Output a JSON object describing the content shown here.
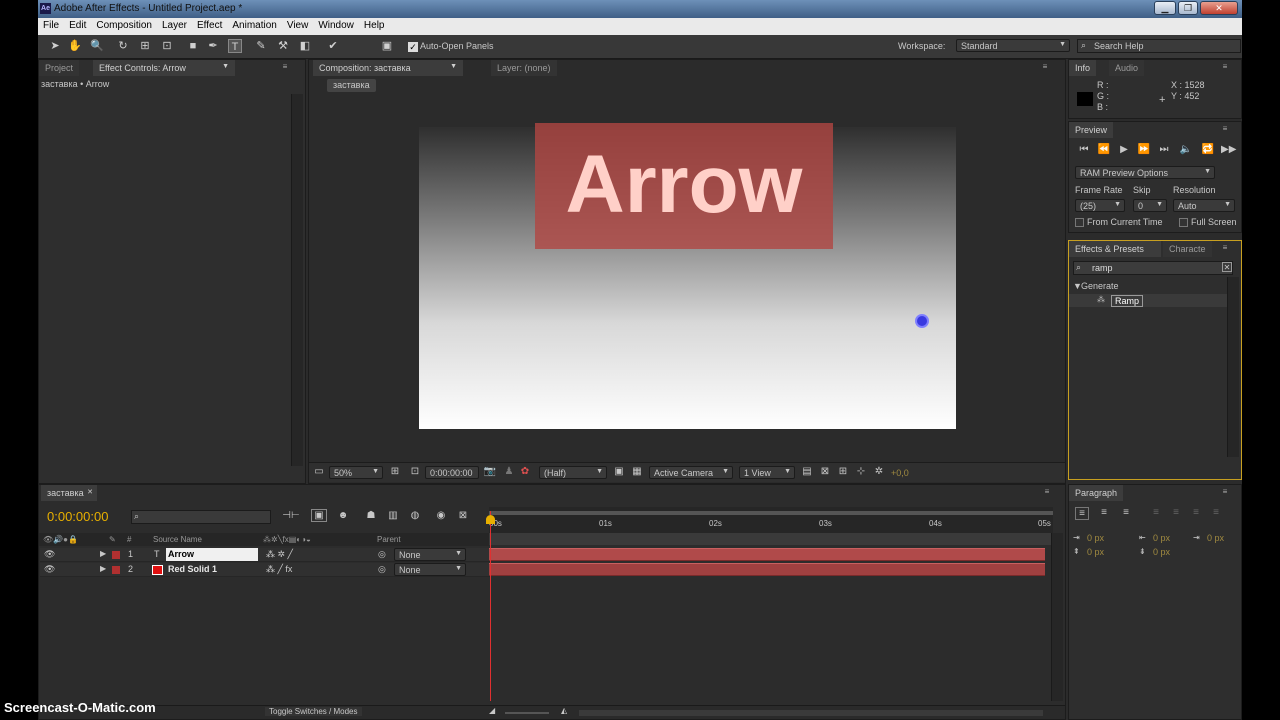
{
  "app": {
    "title": "Adobe After Effects - Untitled Project.aep *",
    "icon_text": "Ae"
  },
  "window_buttons": {
    "minimize": "▁",
    "maximize": "❐",
    "close": "✕"
  },
  "menu": [
    "File",
    "Edit",
    "Composition",
    "Layer",
    "Effect",
    "Animation",
    "View",
    "Window",
    "Help"
  ],
  "toolbar": {
    "auto_open_label": "Auto-Open Panels",
    "workspace_label": "Workspace:",
    "workspace_value": "Standard",
    "search_help": "Search Help"
  },
  "project_panel": {
    "tab_project": "Project",
    "tab_effect_controls": "Effect Controls: Arrow",
    "breadcrumb": "заставка • Arrow"
  },
  "comp_panel": {
    "tab_comp": "Composition: заставка",
    "tab_layer": "Layer: (none)",
    "comp_tab_label": "заставка",
    "comp_text": "Arrow",
    "zoom": "50%",
    "timecode": "0:00:00:00",
    "resolution": "(Half)",
    "camera": "Active Camera",
    "views": "1 View",
    "exposure": "+0,0"
  },
  "info_panel": {
    "tab_info": "Info",
    "tab_audio": "Audio",
    "r": "R :",
    "g": "G :",
    "b": "B :",
    "x": "X : 1528",
    "y": "Y : 452"
  },
  "preview_panel": {
    "tab": "Preview",
    "ram_options": "RAM Preview Options",
    "frame_rate_label": "Frame Rate",
    "skip_label": "Skip",
    "resolution_label": "Resolution",
    "frame_rate": "(25)",
    "skip": "0",
    "resolution": "Auto",
    "from_current": "From Current Time",
    "full_screen": "Full Screen"
  },
  "effects_panel": {
    "tab_effects": "Effects & Presets",
    "tab_character": "Characte",
    "search_value": "ramp",
    "group": "Generate",
    "item": "Ramp"
  },
  "timeline": {
    "tab": "заставка",
    "timecode": "0:00:00:00",
    "col_source": "Source Name",
    "col_parent": "Parent",
    "col_num": "#",
    "ruler": [
      "00s",
      "01s",
      "02s",
      "03s",
      "04s",
      "05s"
    ],
    "layers": [
      {
        "num": "1",
        "type_icon": "T",
        "name": "Arrow",
        "parent": "None",
        "color": "#b03030"
      },
      {
        "num": "2",
        "type_icon": "■",
        "name": "Red Solid 1",
        "parent": "None",
        "color": "#e01010"
      }
    ],
    "toggle_label": "Toggle Switches / Modes"
  },
  "paragraph_panel": {
    "tab": "Paragraph",
    "px1": "0 px",
    "px2": "0 px",
    "px3": "0 px",
    "px4": "0 px",
    "px5": "0 px"
  },
  "watermark": "Screencast-O-Matic.com",
  "colors": {
    "accent": "#e8a000",
    "bar": "#b04a4a",
    "tc": "#e8b000"
  }
}
